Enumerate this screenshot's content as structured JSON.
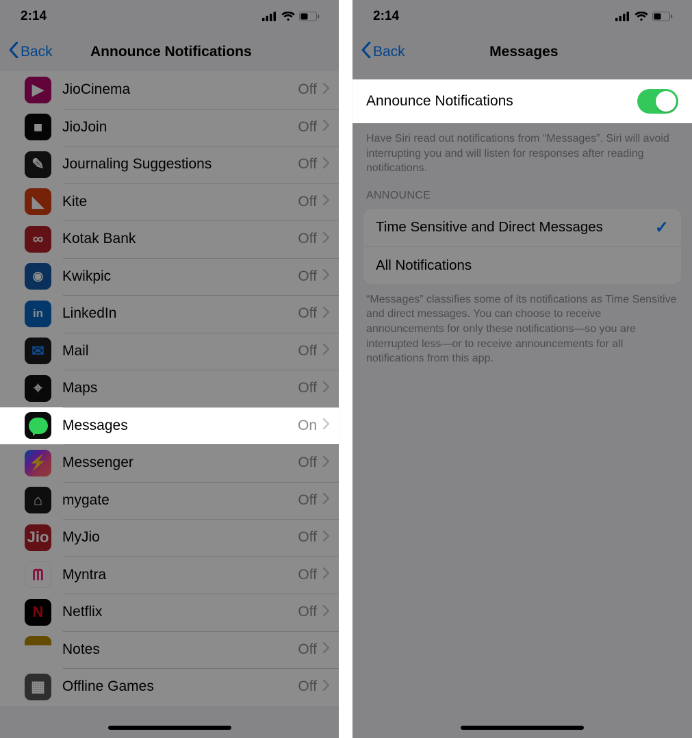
{
  "left": {
    "status_time": "2:14",
    "back_label": "Back",
    "title": "Announce Notifications",
    "value_on": "On",
    "value_off": "Off",
    "apps": [
      {
        "id": "jiocinema",
        "name": "JioCinema",
        "state": "Off"
      },
      {
        "id": "jiojoin",
        "name": "JioJoin",
        "state": "Off"
      },
      {
        "id": "journal",
        "name": "Journaling Suggestions",
        "state": "Off"
      },
      {
        "id": "kite",
        "name": "Kite",
        "state": "Off"
      },
      {
        "id": "kotak",
        "name": "Kotak Bank",
        "state": "Off"
      },
      {
        "id": "kwikpic",
        "name": "Kwikpic",
        "state": "Off"
      },
      {
        "id": "linkedin",
        "name": "LinkedIn",
        "state": "Off"
      },
      {
        "id": "mail",
        "name": "Mail",
        "state": "Off"
      },
      {
        "id": "maps",
        "name": "Maps",
        "state": "Off"
      },
      {
        "id": "messages",
        "name": "Messages",
        "state": "On",
        "highlight": true
      },
      {
        "id": "messenger",
        "name": "Messenger",
        "state": "Off"
      },
      {
        "id": "mygate",
        "name": "mygate",
        "state": "Off"
      },
      {
        "id": "myjio",
        "name": "MyJio",
        "state": "Off"
      },
      {
        "id": "myntra",
        "name": "Myntra",
        "state": "Off"
      },
      {
        "id": "netflix",
        "name": "Netflix",
        "state": "Off"
      },
      {
        "id": "notes",
        "name": "Notes",
        "state": "Off"
      },
      {
        "id": "offline",
        "name": "Offline Games",
        "state": "Off"
      }
    ]
  },
  "right": {
    "status_time": "2:14",
    "back_label": "Back",
    "title": "Messages",
    "toggle_label": "Announce Notifications",
    "toggle_on": true,
    "toggle_footer": "Have Siri read out notifications from “Messages”. Siri will avoid interrupting you and will listen for responses after reading notifications.",
    "section_header": "ANNOUNCE",
    "options": [
      {
        "label": "Time Sensitive and Direct Messages",
        "selected": true
      },
      {
        "label": "All Notifications",
        "selected": false
      }
    ],
    "options_footer": "“Messages” classifies some of its notifications as Time Sensitive and direct messages. You can choose to receive announcements for only these notifications—so you are interrupted less—or to receive announcements for all notifications from this app."
  },
  "icons": {
    "chevron_left": "chevron-left-icon",
    "chevron_right": "chevron-right-icon",
    "signal": "cellular-signal-icon",
    "wifi": "wifi-icon",
    "battery": "battery-icon",
    "checkmark": "checkmark-icon"
  },
  "colors": {
    "accent": "#007aff",
    "toggle_on": "#34c759"
  }
}
